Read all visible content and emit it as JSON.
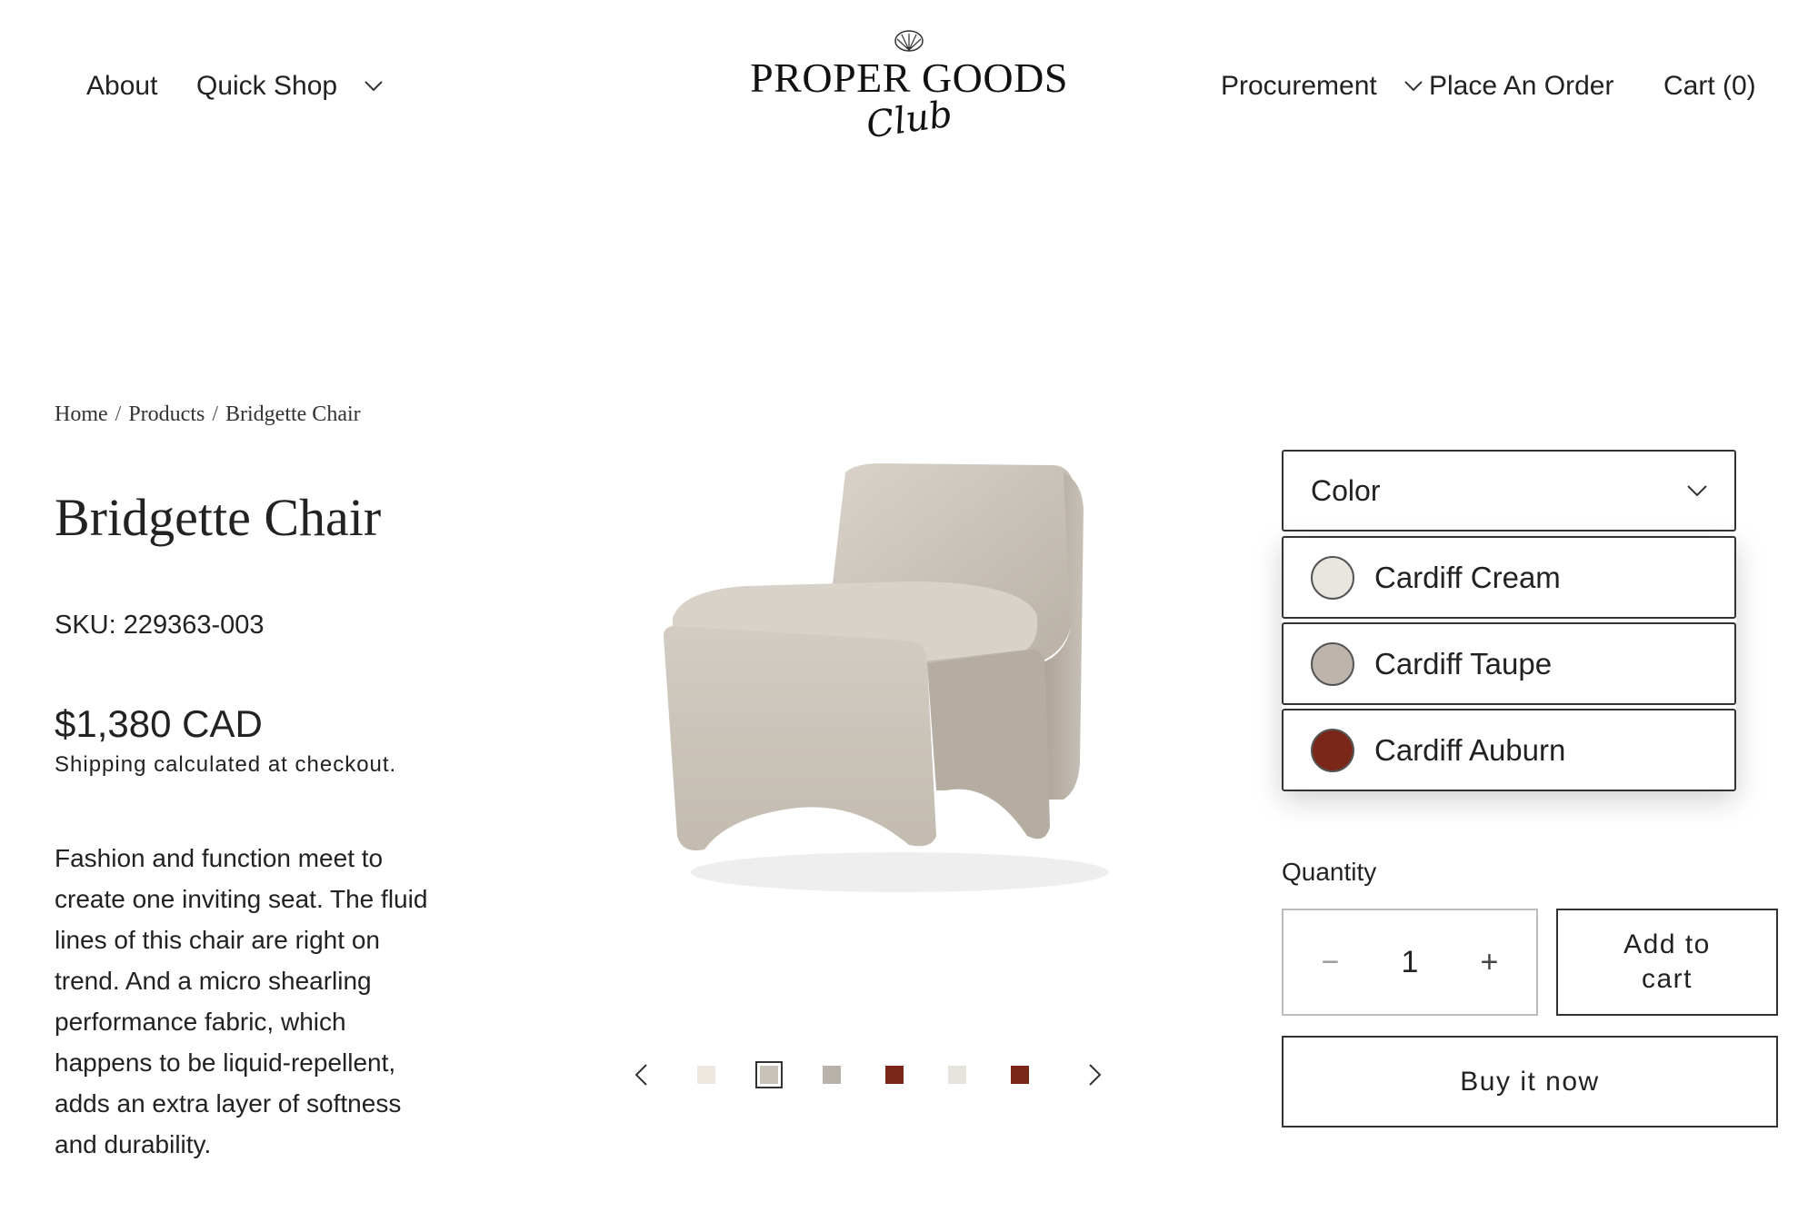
{
  "header": {
    "nav_left": [
      {
        "label": "About"
      },
      {
        "label": "Quick Shop"
      }
    ],
    "nav_right": [
      {
        "label": "Procurement"
      },
      {
        "label": "Place An Order"
      },
      {
        "label": "Cart (0)"
      }
    ],
    "logo": {
      "word": "PROPER GOODS",
      "script": "Club"
    }
  },
  "breadcrumb": [
    "Home",
    "Products",
    "Bridgette Chair"
  ],
  "product": {
    "title": "Bridgette Chair",
    "sku": "SKU: 229363-003",
    "price": "$1,380 CAD",
    "shipping": "Shipping calculated at checkout.",
    "description": "Fashion and function meet to create one inviting seat. The fluid lines of this chair are right on trend. And a micro shearling performance fabric, which happens to be liquid-repellent, adds an extra layer of softness and durability."
  },
  "color_select": {
    "label": "Color",
    "options": [
      {
        "label": "Cardiff Cream",
        "color": "#e8e6df"
      },
      {
        "label": "Cardiff Taupe",
        "color": "#bdb5ac"
      },
      {
        "label": "Cardiff Auburn",
        "color": "#7a2618"
      }
    ]
  },
  "quantity": {
    "label": "Quantity",
    "value": "1",
    "minus": "−",
    "plus": "+"
  },
  "buttons": {
    "add_to_cart": "Add to cart",
    "buy_now": "Buy it now"
  },
  "gallery": {
    "thumbnails": [
      {
        "color": "#ece8df"
      },
      {
        "color": "#c9c2b8"
      },
      {
        "color": "#b9b2aa"
      },
      {
        "color": "#7a2618"
      },
      {
        "color": "#e6e3dc"
      },
      {
        "color": "#7a2618"
      }
    ],
    "active_index": 1
  }
}
